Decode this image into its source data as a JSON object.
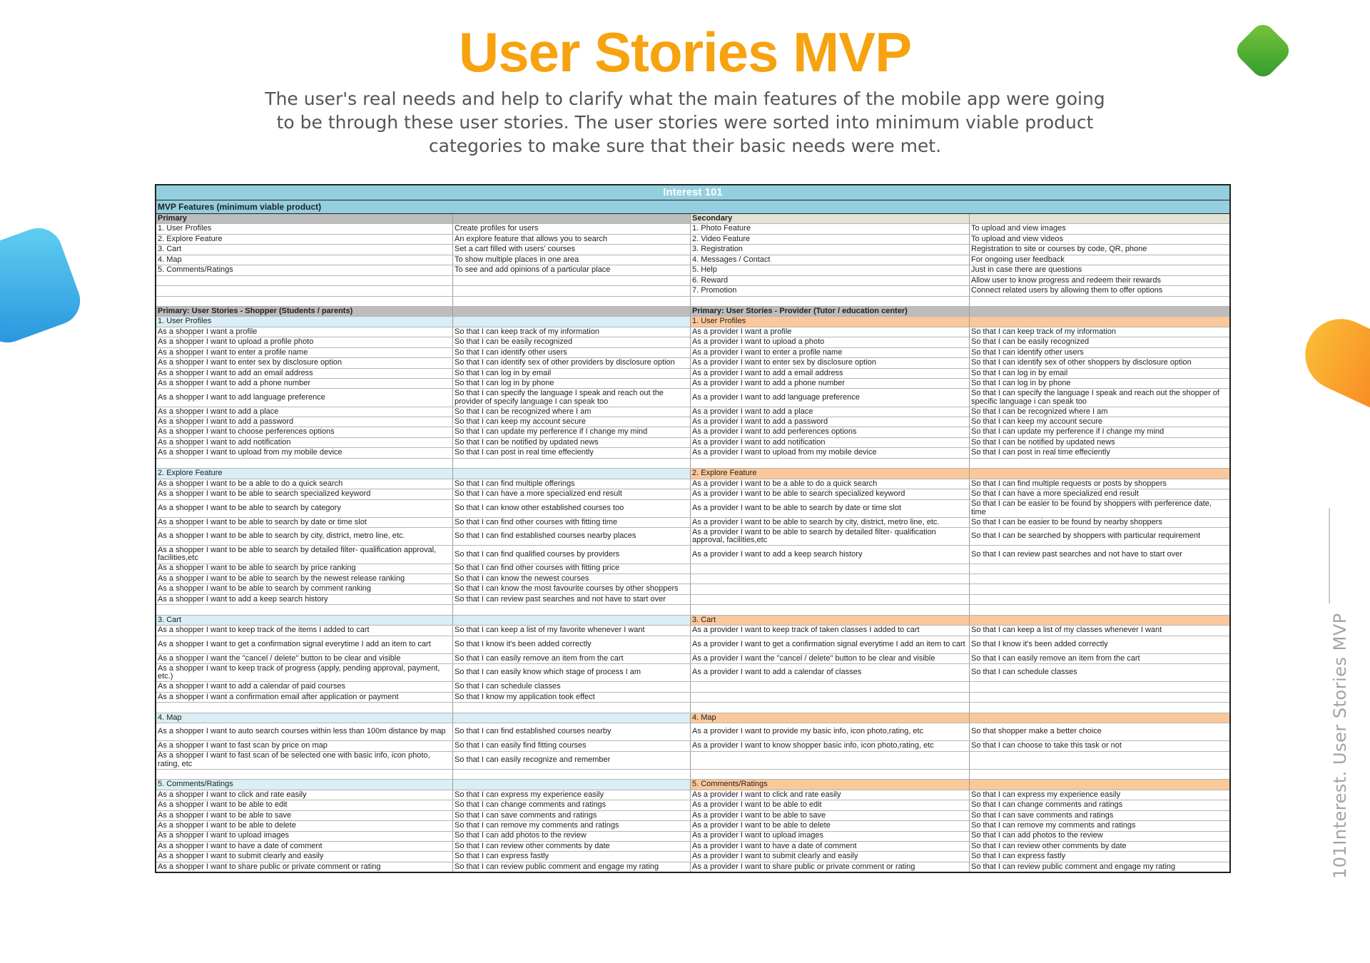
{
  "header": {
    "title": "User Stories MVP",
    "subtitle": "The user's real needs and help to clarify what the main features of the mobile app were going to be through these user stories. The user stories were sorted into minimum viable product categories to make sure that their basic needs were met."
  },
  "side_caption": "101Interest.  User Stories MVP",
  "colors": {
    "title": "#f7a20f",
    "sheet_header": "#93cfde",
    "provider_section": "#fbc89b",
    "shopper_section": "#d9eef5",
    "gray_header": "#bdbdbd"
  },
  "sheet": {
    "title": "Interest 101",
    "mvp_label": "MVP Features (minimum viable product)",
    "rows": [
      {
        "cells": [
          "Primary",
          "",
          "Secondary",
          ""
        ],
        "style": "hdr",
        "bg": [
          "gray",
          "gray",
          "beige",
          "beige"
        ]
      },
      {
        "cells": [
          "1. User Profiles",
          "Create profiles for users",
          "1. Photo Feature",
          "To upload and view images"
        ]
      },
      {
        "cells": [
          "2. Explore Feature",
          "An explore feature that allows you to search",
          "2. Video Feature",
          "To upload and view videos"
        ]
      },
      {
        "cells": [
          "3. Cart",
          "Set a cart filled with users' courses",
          "3. Registration",
          "Registration to site or courses by code, QR, phone"
        ]
      },
      {
        "cells": [
          "4. Map",
          "To show multiple places in one area",
          "4. Messages / Contact",
          "For ongoing user feedback"
        ]
      },
      {
        "cells": [
          "5. Comments/Ratings",
          "To see and add opinions of a particular place",
          "5. Help",
          "Just in case there are questions"
        ]
      },
      {
        "cells": [
          "",
          "",
          "6. Reward",
          "Allow user to know progress and redeem their rewards"
        ]
      },
      {
        "cells": [
          "",
          "",
          "7. Promotion",
          "Connect related users by allowing them to offer options"
        ]
      },
      {
        "cells": [
          "",
          "",
          "",
          ""
        ]
      },
      {
        "cells": [
          "Primary: User Stories - Shopper (Students / parents)",
          "",
          "Primary: User Stories - Provider (Tutor / education center)",
          ""
        ],
        "style": "hdr",
        "bg": [
          "gray",
          "gray",
          "gray",
          "gray"
        ]
      },
      {
        "cells": [
          "1. User Profiles",
          "",
          "1. User Profiles",
          ""
        ],
        "bg": [
          "blue",
          "blue",
          "orange",
          "orange"
        ]
      },
      {
        "cells": [
          "As a shopper I want a profile",
          "So that I can keep track of my information",
          "As a provider I want a profile",
          "So that I can keep track of my information"
        ]
      },
      {
        "cells": [
          "As a shopper I want to upload a profile photo",
          "So that I can be easily recognized",
          "As a provider I want to upload a photo",
          "So that I can be easily recognized"
        ]
      },
      {
        "cells": [
          "As a shopper I want to enter a profile name",
          "So that I can identify other users",
          "As a provider I want to enter a profile name",
          "So that I can identify other users"
        ]
      },
      {
        "cells": [
          "As a shopper I want to enter sex by disclosure option",
          "So that I can identify sex of other providers by disclosure option",
          "As a provider I want to enter sex by disclosure option",
          "So that I can identify sex of other shoppers by disclosure option"
        ]
      },
      {
        "cells": [
          "As a shopper I want to add an email address",
          "So that I can log in by email",
          "As a provider I want to add a email address",
          "So that I can log in by email"
        ]
      },
      {
        "cells": [
          "As a shopper I want to add a phone number",
          "So that I can log in by phone",
          "As a provider I want to add a phone number",
          "So that I can log in by phone"
        ]
      },
      {
        "cells": [
          "As a shopper I want to add language preference",
          "So that I can specify the language I speak and reach out the provider of specify language I can speak too",
          "As a provider I want to add language preference",
          "So that I can specify the language I speak and reach out the shopper of specific language i can speak too"
        ],
        "tall": true
      },
      {
        "cells": [
          "As a shopper I want to add a place",
          "So that I can be recognized where I am",
          "As a provider I want to add a place",
          "So that I can be recognized where I am"
        ]
      },
      {
        "cells": [
          "As a shopper I want to add a password",
          "So that I can keep my account secure",
          "As a provider I want to add a password",
          "So that I can keep my account secure"
        ]
      },
      {
        "cells": [
          "As a shopper I want to choose perferences options",
          "So that I can update my perference if I change my mind",
          "As a provider I want to add perferences options",
          "So that I can update my perference if I change my mind"
        ]
      },
      {
        "cells": [
          "As a shopper I want to add notification",
          "So that I can be notified by updated news",
          "As a provider I want to add notification",
          "So that I can be notified by updated news"
        ]
      },
      {
        "cells": [
          "As a shopper I want to upload from my mobile device",
          "So that I can post in real time effeciently",
          "As a provider I want to upload from my mobile device",
          "So that I can post in real time effeciently"
        ]
      },
      {
        "cells": [
          "",
          "",
          "",
          ""
        ]
      },
      {
        "cells": [
          "2. Explore Feature",
          "",
          "2. Explore Feature",
          ""
        ],
        "bg": [
          "blue",
          "blue",
          "orange",
          "orange"
        ]
      },
      {
        "cells": [
          "As a shopper I want to be a able to do a quick search",
          "So that I can find multiple offerings",
          "As a provider I want to be a able to do a quick search",
          "So that I can find multiple requests or posts by shoppers"
        ]
      },
      {
        "cells": [
          "As a shopper I want to be able to search specialized keyword",
          "So that I can have a more specialized end result",
          "As a provider I want to be able to search specialized keyword",
          "So that I can have a more specialized end result"
        ]
      },
      {
        "cells": [
          "As a shopper I want to be able to search by category",
          "So that I can know other established courses too",
          "As a provider I want to be able to search by date or time slot",
          "So that I can be easier to be found by shoppers with perference date, time"
        ],
        "tall": true
      },
      {
        "cells": [
          "As a shopper I want to be able to search by date or time slot",
          "So that I can find other courses with fitting time",
          "As a provider I want to be able to search by city, district, metro line, etc.",
          "So that I can be easier to be found by nearby shoppers"
        ]
      },
      {
        "cells": [
          "As a shopper I want to be able to search by city, district, metro line, etc.",
          "So that I can find established courses nearby places",
          "As a provider I want to be able to search by detailed filter- qualification approval, facilities,etc",
          "So that I can be searched by shoppers with particular requirement"
        ],
        "tall": true
      },
      {
        "cells": [
          "As a shopper I want to be able to search by detailed filter- qualification approval, facilities,etc",
          "So that I can find qualified courses by providers",
          "As a provider I want to add a keep search history",
          "So that I can review past searches and not have to start over"
        ],
        "tall": true
      },
      {
        "cells": [
          "As a shopper I want to be able to search by price ranking",
          "So that I can find other courses with fitting price",
          "",
          ""
        ]
      },
      {
        "cells": [
          "As a shopper I want to be able to search by the newest release ranking",
          "So that I can know the newest courses",
          "",
          ""
        ]
      },
      {
        "cells": [
          "As a shopper I want to be able to search by comment ranking",
          "So that I can know the most favourite courses by other shoppers",
          "",
          ""
        ]
      },
      {
        "cells": [
          "As a shopper I want to add a keep search history",
          "So that I can review past searches and not have to start over",
          "",
          ""
        ]
      },
      {
        "cells": [
          "",
          "",
          "",
          ""
        ]
      },
      {
        "cells": [
          "3. Cart",
          "",
          "3. Cart",
          ""
        ],
        "bg": [
          "blue",
          "blue",
          "orange",
          "orange"
        ]
      },
      {
        "cells": [
          "As a shopper I want to keep track of the items I added to cart",
          "So that I can keep a list of my favorite whenever I want",
          "As a provider I want to keep track of taken classes I added to cart",
          "So that I can keep a list of my classes whenever I want"
        ]
      },
      {
        "cells": [
          "As a shopper I want to get a confirmation signal everytime I add an item to cart",
          "So that I know it's been added correctly",
          "As a provider I want to get a confirmation signal everytime I add an item to cart",
          "So that I know it's been added correctly"
        ],
        "tall": true
      },
      {
        "cells": [
          "As a shopper I want the \"cancel / delete\" button to be clear and visible",
          "So that I can easily remove an item from the cart",
          "As a provider I want the \"cancel / delete\" button to be clear and visible",
          "So that I can easily remove an item from the cart"
        ]
      },
      {
        "cells": [
          "As a shopper I want to keep track of progress (apply, pending approval, payment, etc.)",
          "So that I can easily know which stage of process I am",
          "As a provider I want to add a calendar of classes",
          "So that I can schedule classes"
        ],
        "tall": true
      },
      {
        "cells": [
          "As a shopper I want to add a calendar of paid courses",
          "So that I can schedule classes",
          "",
          ""
        ]
      },
      {
        "cells": [
          "As a shopper I want a confirmation email after application or payment",
          "So that I know my application took effect",
          "",
          ""
        ]
      },
      {
        "cells": [
          "",
          "",
          "",
          ""
        ]
      },
      {
        "cells": [
          "4. Map",
          "",
          "4. Map",
          ""
        ],
        "bg": [
          "blue",
          "blue",
          "orange",
          "orange"
        ]
      },
      {
        "cells": [
          "As a shopper I want to auto search courses within less than 100m distance by map",
          "So that I can find established courses nearby",
          "As a provider I want to provide my basic info, icon photo,rating, etc",
          "So that shopper make a better choice"
        ],
        "tall": true
      },
      {
        "cells": [
          "As a shopper I want to fast scan by price on map",
          "So that I can easily find fitting courses",
          "As a provider I want to know shopper basic info, icon photo,rating, etc",
          "So that I can choose to take this task or not"
        ]
      },
      {
        "cells": [
          "As a shopper I want to fast scan of be selected one with basic info, icon photo, rating, etc",
          "So that I can easily recognize and remember",
          "",
          ""
        ],
        "tall": true
      },
      {
        "cells": [
          "",
          "",
          "",
          ""
        ]
      },
      {
        "cells": [
          "5. Comments/Ratings",
          "",
          "5. Comments/Ratings",
          ""
        ],
        "bg": [
          "blue",
          "blue",
          "orange",
          "orange"
        ]
      },
      {
        "cells": [
          "As a shopper I want to click and rate easily",
          "So that I can express my experience easily",
          "As a provider I want to click and rate easily",
          "So that I can express my experience easily"
        ]
      },
      {
        "cells": [
          "As a shopper I want to be able to edit",
          "So that I can change comments and ratings",
          "As a provider I want to be able to edit",
          "So that I can change comments and ratings"
        ]
      },
      {
        "cells": [
          "As a shopper I want to be able to save",
          "So that I can save comments and ratings",
          "As a provider I want to be able to save",
          "So that I can save comments and ratings"
        ]
      },
      {
        "cells": [
          "As a shopper I want to be able to delete",
          "So that I can remove my comments and ratings",
          "As a provider I want to be able to delete",
          "So that I can remove my comments and ratings"
        ]
      },
      {
        "cells": [
          "As a shopper I want to upload images",
          "So that I can add photos to the review",
          "As a provider I want to upload images",
          "So that I can add photos to the review"
        ]
      },
      {
        "cells": [
          "As a shopper I want to have a date of comment",
          "So that I can review other comments by date",
          "As a provider I want to have a date of comment",
          "So that I can review other comments by date"
        ]
      },
      {
        "cells": [
          "As a shopper I want to submit clearly and easily",
          "So that I can express fastly",
          "As a provider I want to submit clearly and easily",
          "So that I can express fastly"
        ]
      },
      {
        "cells": [
          "As a shopper I want to share public or private comment or rating",
          "So that I can review public comment and engage my rating",
          "As a provider I want to share public or private comment or rating",
          "So that I can review public comment and engage my rating"
        ]
      }
    ]
  }
}
